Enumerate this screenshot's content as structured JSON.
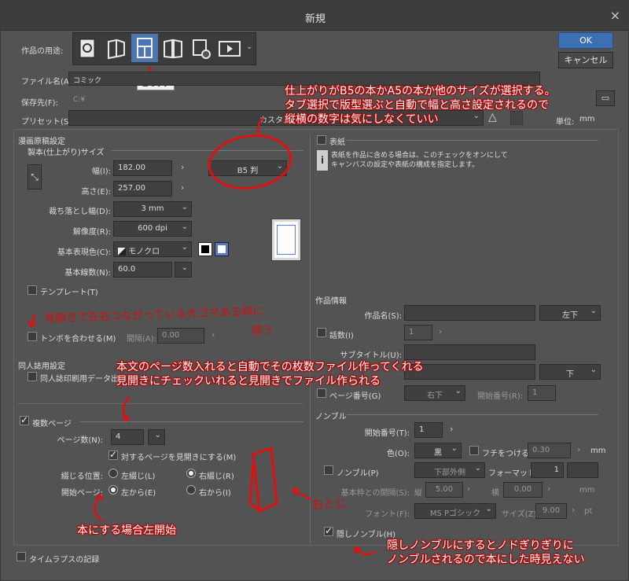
{
  "window": {
    "title": "新規",
    "close": "×"
  },
  "buttons": {
    "ok": "OK",
    "cancel": "キャンセル"
  },
  "usage": {
    "label": "作品の用途:",
    "tooltip": "コミック",
    "icons": [
      "illustration-icon",
      "webtoon-icon",
      "comic-icon",
      "print-icon",
      "everything-icon",
      "animation-icon"
    ]
  },
  "file": {
    "name_label": "ファイル名(A):",
    "name_value": "コミック",
    "save_label": "保存先(F):",
    "save_value": "C:¥",
    "preset_label": "プリセット(S):",
    "preset_value": "カスタム",
    "unit_label": "単位:",
    "unit_value": "mm"
  },
  "manga": {
    "section": "漫画原稿設定",
    "subsection": "製本(仕上がり)サイズ",
    "width_label": "幅(I):",
    "width_value": "182.00",
    "height_label": "高さ(E):",
    "height_value": "257.00",
    "size_preset": "B5 判",
    "bleed_label": "裁ち落とし幅(D):",
    "bleed_value": "3 mm",
    "res_label": "解像度(R):",
    "res_value": "600 dpi",
    "color_label": "基本表現色(C):",
    "color_value": "モノクロ",
    "lines_label": "基本線数(N):",
    "lines_value": "60.0",
    "template_label": "テンプレート(T)",
    "tombo_label": "トンボを合わせる(M)",
    "gap_label": "間隔(A):",
    "gap_value": "0.00"
  },
  "doujin": {
    "section": "同人誌用設定",
    "print_label": "同人誌印刷用データ出"
  },
  "multipage": {
    "label": "複数ページ",
    "pages_label": "ページ数(N):",
    "pages_value": "4",
    "spread_label": "対するページを見開きにする(M)",
    "binding_label": "綴じる位置:",
    "bind_left": "左綴じ(L)",
    "bind_right": "右綴じ(R)",
    "start_label": "開始ページ:",
    "start_left": "左から(E)",
    "start_right": "右から(I)"
  },
  "timelapse": {
    "label": "タイムラプスの記録"
  },
  "cover": {
    "label": "表紙",
    "info": [
      "表紙を作品に含める場合は、このチェックをオンにして",
      "キャンバスの設定や表紙の構成を指定します。"
    ]
  },
  "work": {
    "section": "作品情報",
    "title_label": "作品名(S):",
    "title_pos": "左下",
    "episode_label": "話数(I)",
    "episode_value": "1",
    "subtitle_label": "サブタイトル(U):",
    "author_pos": "下",
    "pagenum_label": "ページ番号(G)",
    "pagenum_pos": "右下",
    "startnum_label": "開始番号(R):",
    "startnum_value": "1"
  },
  "nombre": {
    "section": "ノンブル",
    "start_label": "開始番号(T):",
    "start_value": "1",
    "color_label": "色(O):",
    "color_value": "黒",
    "fuchi_label": "フチをつける(E)",
    "fuchi_value": "0.30",
    "fuchi_unit": "mm",
    "nombre_label": "ノンブル(P)",
    "nombre_pos": "下部外側",
    "format_label": "フォーマット:",
    "format_value": "1",
    "gap_label": "基本枠との間隔(S):",
    "vert_label": "縦",
    "vert_value": "5.00",
    "horiz_label": "横",
    "horiz_value": "0.00",
    "gap_unit": "mm",
    "font_label": "フォント(F):",
    "font_value": "MS Pゴシック",
    "size_label": "サイズ(Z):",
    "size_value": "9.00",
    "size_unit": "pt",
    "hidden_label": "隠しノンブル(H)"
  },
  "annotations": {
    "size_note": [
      "仕上がりがB5の本かA5の本か他のサイズが選択する。",
      "タブ選択で版型選ぶと自動で幅と高さ設定されるので",
      "縦横の数字は気にしなくていい"
    ],
    "tombo_note": [
      "見開きで左右つながっている大ゴマある時に",
      "使う"
    ],
    "page_note": [
      "本文のページ数入れると自動でその枚数ファイル作ってくれる",
      "見開きにチェックいれると見開きでファイル作られる"
    ],
    "left_start_note": "本にする場合左開始",
    "right_bind_note": "右とじ",
    "hidden_note": [
      "隠しノンブルにするとノドぎりぎりに",
      "ノンブルされるので本にした時見えない"
    ]
  }
}
